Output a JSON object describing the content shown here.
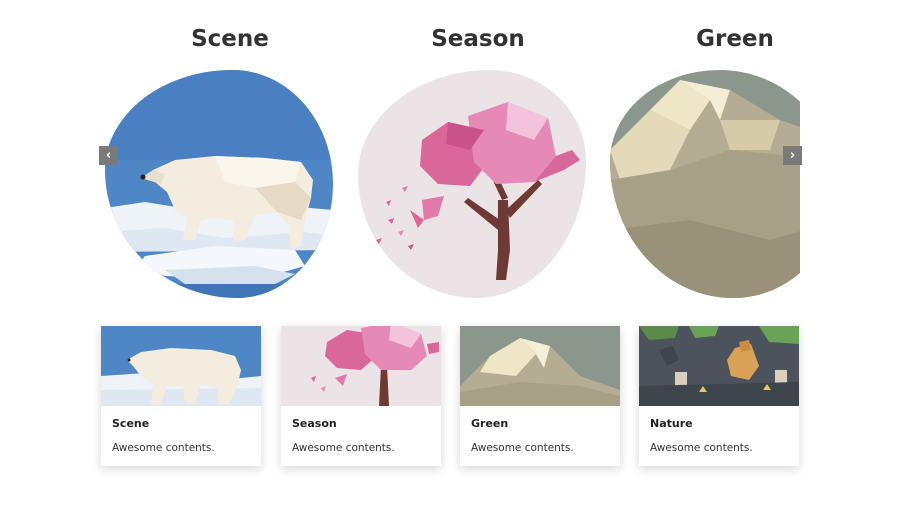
{
  "carousel": {
    "slides": [
      {
        "title": "Scene"
      },
      {
        "title": "Season"
      },
      {
        "title": "Green"
      }
    ],
    "prev_icon": "chevron-left-icon",
    "next_icon": "chevron-right-icon",
    "prev_glyph": "‹",
    "next_glyph": "›"
  },
  "cards": [
    {
      "title": "Scene",
      "description": "Awesome contents."
    },
    {
      "title": "Season",
      "description": "Awesome contents."
    },
    {
      "title": "Green",
      "description": "Awesome contents."
    },
    {
      "title": "Nature",
      "description": "Awesome contents."
    }
  ],
  "colors": {
    "sky_blue": "#4f86c6",
    "season_bg": "#ebe3e6",
    "blossom_pink": "#d9679a",
    "mountain_grey": "#8b968d",
    "mountain_tan": "#a89f87",
    "arrow_bg": "#7a7a7a"
  }
}
